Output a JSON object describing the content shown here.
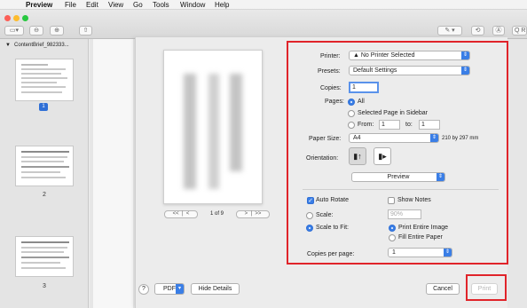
{
  "menubar": {
    "app_name": "Preview",
    "items": [
      "File",
      "Edit",
      "View",
      "Go",
      "Tools",
      "Window",
      "Help"
    ]
  },
  "sidebar": {
    "title": "ContentBrief_982333...",
    "pages": [
      {
        "number": "1",
        "selected": true
      },
      {
        "number": "2",
        "selected": false
      },
      {
        "number": "3",
        "selected": false
      }
    ]
  },
  "preview": {
    "page_indicator": "1 of 9",
    "prev_first": "<<",
    "prev": "<",
    "next": ">",
    "next_last": ">>"
  },
  "print": {
    "printer_label": "Printer:",
    "printer_value": "▲ No Printer Selected",
    "presets_label": "Presets:",
    "presets_value": "Default Settings",
    "copies_label": "Copies:",
    "copies_value": "1",
    "pages_label": "Pages:",
    "pages_all": "All",
    "pages_selected_sidebar": "Selected Page in Sidebar",
    "pages_from": "From:",
    "pages_from_value": "1",
    "pages_to": "to:",
    "pages_to_value": "1",
    "paper_size_label": "Paper Size:",
    "paper_size_value": "A4",
    "paper_size_dims": "210 by 297 mm",
    "orientation_label": "Orientation:",
    "section_value": "Preview",
    "auto_rotate": "Auto Rotate",
    "show_notes": "Show Notes",
    "scale_label": "Scale:",
    "scale_value": "90%",
    "scale_to_fit": "Scale to Fit:",
    "print_entire_image": "Print Entire Image",
    "fill_entire_paper": "Fill Entire Paper",
    "copies_per_page_label": "Copies per page:",
    "copies_per_page_value": "1"
  },
  "footer": {
    "help": "?",
    "pdf": "PDF",
    "hide_details": "Hide Details",
    "cancel": "Cancel",
    "print": "Print"
  },
  "colors": {
    "accent": "#3a7ee6",
    "highlight_box": "#e0242a"
  }
}
